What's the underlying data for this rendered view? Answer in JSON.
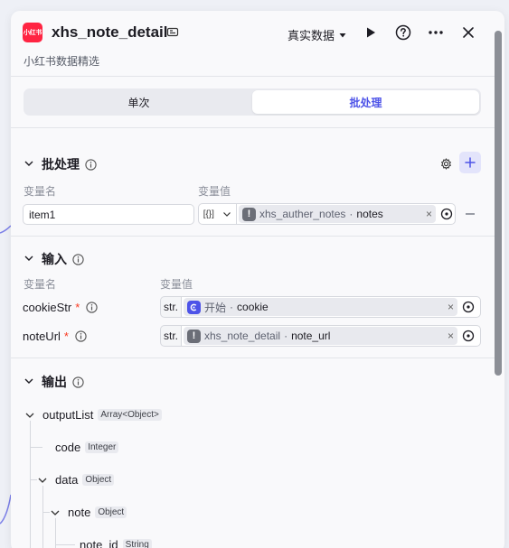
{
  "header": {
    "logo_text": "小红书",
    "title": "xhs_note_detail",
    "description": "小红书数据精选",
    "mode_label": "真实数据"
  },
  "tabs": [
    {
      "label": "单次",
      "active": false
    },
    {
      "label": "批处理",
      "active": true
    }
  ],
  "batch": {
    "title": "批处理",
    "col_name": "变量名",
    "col_value": "变量值",
    "row": {
      "name": "item1",
      "type_symbol": "[{}]",
      "source_node": "xhs_auther_notes",
      "separator": "·",
      "source_var": "notes"
    }
  },
  "input": {
    "title": "输入",
    "col_name": "变量名",
    "col_value": "变量值",
    "rows": [
      {
        "name": "cookieStr",
        "required": "*",
        "type": "str.",
        "source_node": "开始",
        "separator": "·",
        "source_var": "cookie"
      },
      {
        "name": "noteUrl",
        "required": "*",
        "type": "str.",
        "source_node": "xhs_note_detail",
        "separator": "·",
        "source_var": "note_url"
      }
    ]
  },
  "output": {
    "title": "输出",
    "tree": [
      {
        "name": "outputList",
        "type": "Array<Object>"
      },
      {
        "name": "code",
        "type": "Integer"
      },
      {
        "name": "data",
        "type": "Object"
      },
      {
        "name": "note",
        "type": "Object"
      },
      {
        "name": "note_id",
        "type": "String"
      }
    ]
  },
  "colors": {
    "accent": "#4d53e8",
    "brand": "#ff2442",
    "start_icon": "#4d53e8",
    "node_icon": "#6b6e77"
  }
}
